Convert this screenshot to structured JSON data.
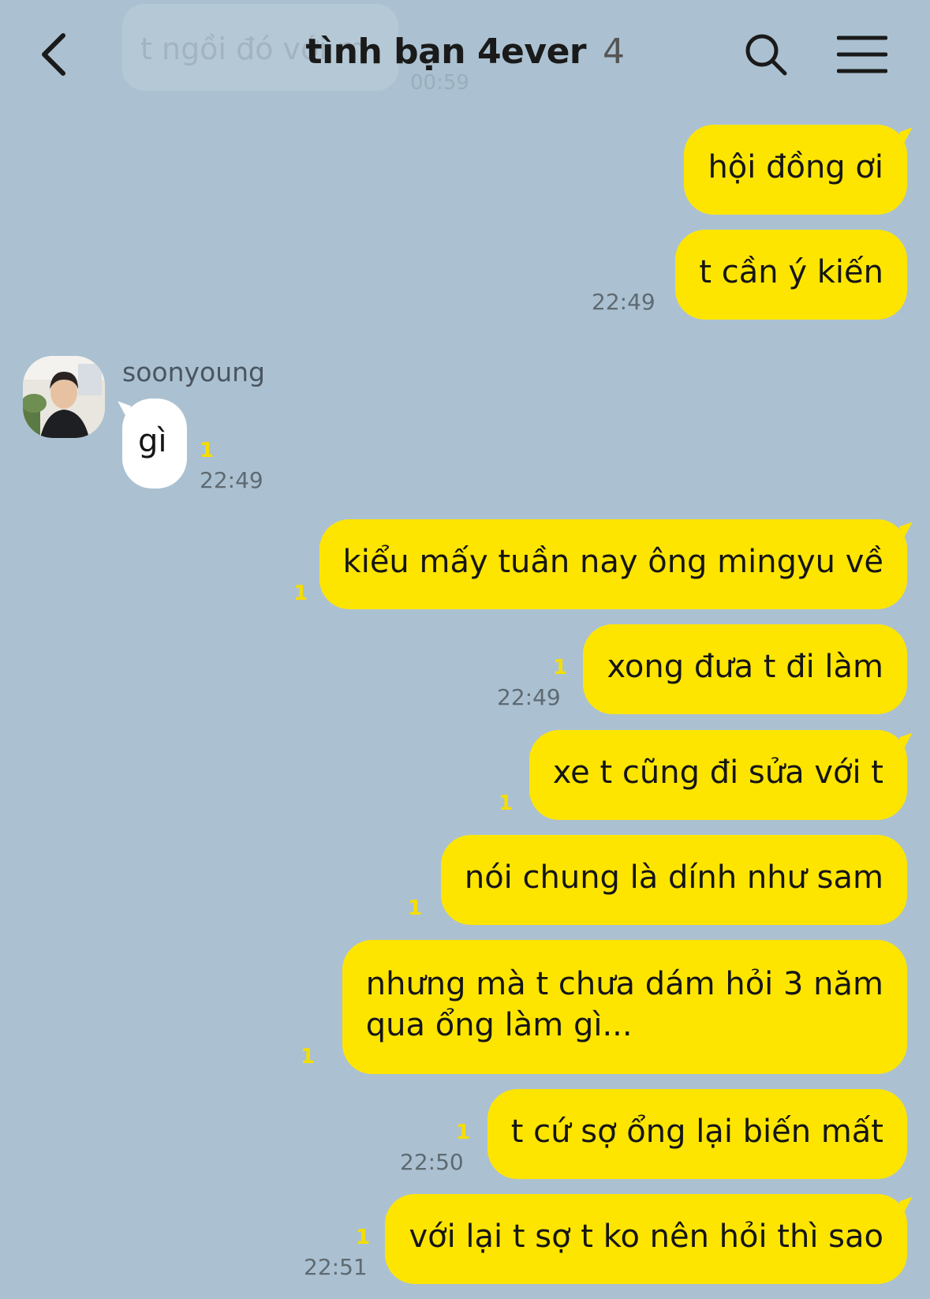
{
  "header": {
    "title": "tình bạn 4ever",
    "member_count": "4"
  },
  "ghost": {
    "text": "t ngồi đó với m",
    "time": "00:59"
  },
  "messages": [
    {
      "text": "hội đồng ơi"
    },
    {
      "text": "t cần ý kiến",
      "time": "22:49"
    },
    {
      "sender": "soonyoung",
      "text": "gì",
      "unread": "1",
      "time": "22:49"
    },
    {
      "text": "kiểu mấy tuần nay ông mingyu về",
      "unread": "1"
    },
    {
      "text": "xong đưa t đi làm",
      "unread": "1",
      "time": "22:49"
    },
    {
      "text": "xe t cũng đi sửa với t",
      "unread": "1"
    },
    {
      "text": "nói chung là dính như sam",
      "unread": "1"
    },
    {
      "text_line1": "nhưng mà t chưa dám hỏi 3 năm",
      "text_line2": "qua ổng làm gì...",
      "unread": "1"
    },
    {
      "text": "t cứ sợ ổng lại biến mất",
      "unread": "1",
      "time": "22:50"
    },
    {
      "text": "với lại t sợ t ko nên hỏi thì sao",
      "unread": "1",
      "time": "22:51"
    }
  ],
  "colors": {
    "background": "#abc1d1",
    "outgoing_bubble": "#fee500",
    "incoming_bubble": "#ffffff",
    "unread": "#f5dd00"
  },
  "icons": {
    "back": "chevron-left-icon",
    "search": "search-icon",
    "menu": "menu-icon"
  }
}
